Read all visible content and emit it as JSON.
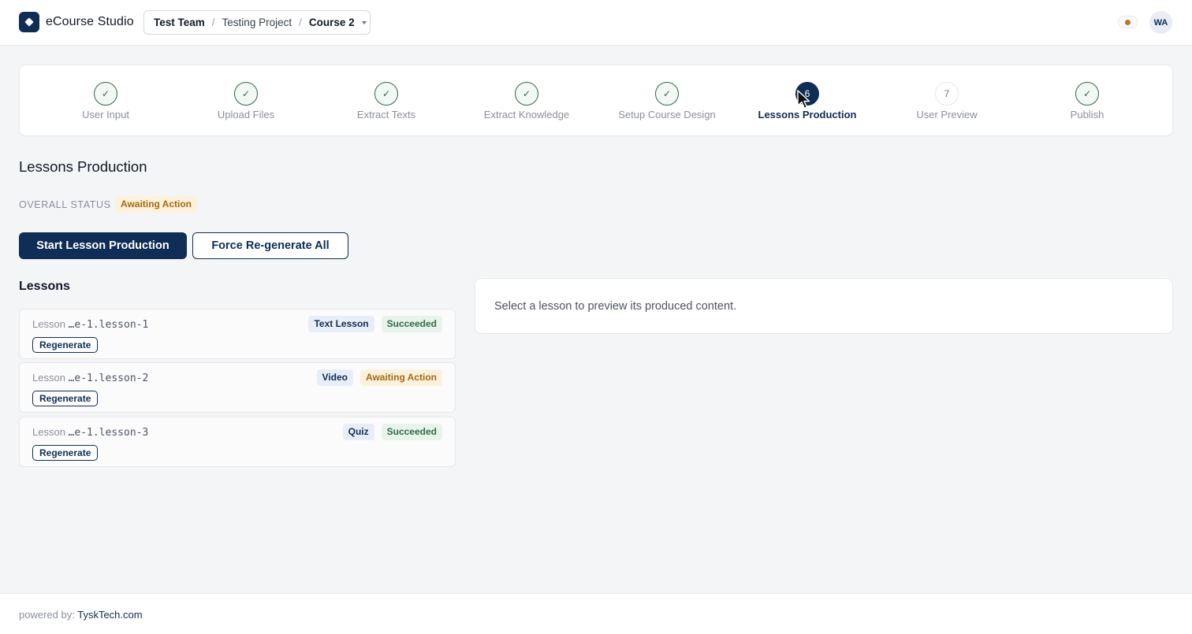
{
  "header": {
    "brand": "eCourse Studio",
    "breadcrumb": {
      "team": "Test Team",
      "project": "Testing Project",
      "course": "Course 2",
      "separator": "/"
    },
    "avatar_initials": "WA",
    "status_dot_color": "#b7791f"
  },
  "stepper": {
    "steps": [
      {
        "label": "User Input",
        "state": "done",
        "mark": "✓"
      },
      {
        "label": "Upload Files",
        "state": "done",
        "mark": "✓"
      },
      {
        "label": "Extract Texts",
        "state": "done",
        "mark": "✓"
      },
      {
        "label": "Extract Knowledge",
        "state": "done",
        "mark": "✓"
      },
      {
        "label": "Setup Course Design",
        "state": "done",
        "mark": "✓"
      },
      {
        "label": "Lessons Production",
        "state": "active",
        "mark": "6"
      },
      {
        "label": "User Preview",
        "state": "pending",
        "mark": "7"
      },
      {
        "label": "Publish",
        "state": "done",
        "mark": "✓"
      }
    ]
  },
  "main": {
    "title": "Lessons Production",
    "overall_status_label": "OVERALL STATUS",
    "overall_status": "Awaiting Action",
    "start_button": "Start Lesson Production",
    "force_button": "Force Re-generate All",
    "lessons_title": "Lessons",
    "lessons": [
      {
        "prefix": "Lesson",
        "code": "…e-1.lesson-1",
        "type": "Text Lesson",
        "status": "Succeeded",
        "status_kind": "ok",
        "action": "Regenerate"
      },
      {
        "prefix": "Lesson",
        "code": "…e-1.lesson-2",
        "type": "Video",
        "status": "Awaiting Action",
        "status_kind": "warn",
        "action": "Regenerate"
      },
      {
        "prefix": "Lesson",
        "code": "…e-1.lesson-3",
        "type": "Quiz",
        "status": "Succeeded",
        "status_kind": "ok",
        "action": "Regenerate"
      }
    ],
    "preview_text": "Select a lesson to preview its produced content."
  },
  "footer": {
    "prefix": "powered by:",
    "link": "TyskTech.com"
  },
  "colors": {
    "primary": "#0f2d55",
    "success": "#2f6b47",
    "warning": "#a66a12"
  }
}
